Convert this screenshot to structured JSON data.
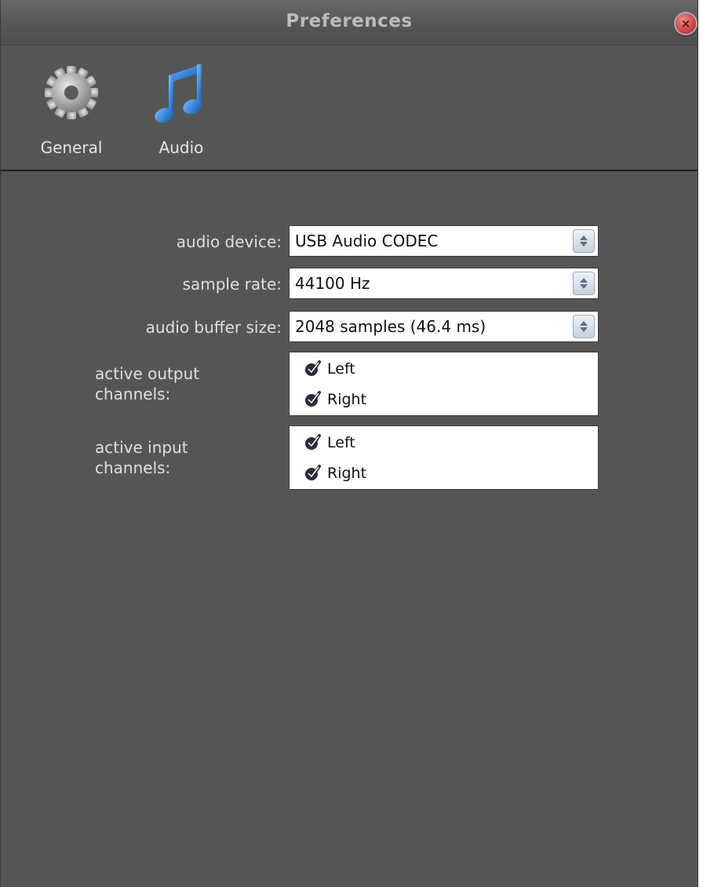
{
  "window": {
    "title": "Preferences"
  },
  "toolbar": {
    "items": [
      {
        "label": "General",
        "icon": "gear-icon"
      },
      {
        "label": "Audio",
        "icon": "music-note-icon"
      }
    ]
  },
  "form": {
    "audio_device": {
      "label": "audio device:",
      "value": "USB Audio CODEC"
    },
    "sample_rate": {
      "label": "sample rate:",
      "value": "44100 Hz"
    },
    "buffer_size": {
      "label": "audio buffer size:",
      "value": "2048 samples (46.4 ms)"
    },
    "output_channels": {
      "label_line1": "active output",
      "label_line2": "channels:",
      "items": [
        {
          "label": "Left",
          "checked": true
        },
        {
          "label": "Right",
          "checked": true
        }
      ]
    },
    "input_channels": {
      "label_line1": "active input",
      "label_line2": "channels:",
      "items": [
        {
          "label": "Left",
          "checked": true
        },
        {
          "label": "Right",
          "checked": true
        }
      ]
    }
  },
  "colors": {
    "window_bg": "#555555",
    "accent_blue": "#2f7fd6",
    "close_red": "#c83a3a"
  }
}
